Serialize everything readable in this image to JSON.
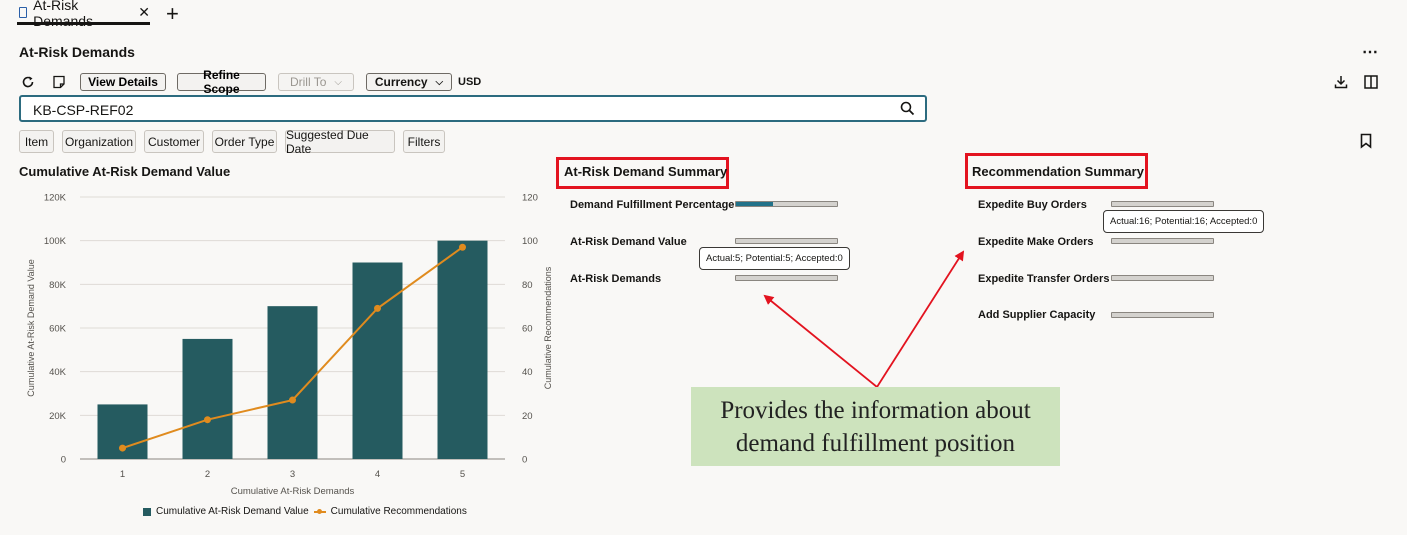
{
  "tab": {
    "label": "At-Risk Demands"
  },
  "page": {
    "title": "At-Risk Demands",
    "more": "⋯"
  },
  "toolbar": {
    "view_details": "View Details",
    "refine_scope": "Refine Scope",
    "drill_to": "Drill To",
    "currency": "Currency",
    "currency_value": "USD"
  },
  "search": {
    "value": "KB-CSP-REF02"
  },
  "filters": [
    "Item",
    "Organization",
    "Customer",
    "Order Type",
    "Suggested Due Date",
    "Filters"
  ],
  "chart_data": {
    "type": "bar",
    "title": "Cumulative At-Risk Demand Value",
    "xlabel": "Cumulative At-Risk Demands",
    "ylabel": "Cumulative At-Risk Demand Value",
    "y2label": "Cumulative Recommendations",
    "categories": [
      "1",
      "2",
      "3",
      "4",
      "5"
    ],
    "ylim": [
      0,
      120000
    ],
    "y2lim": [
      0,
      120
    ],
    "yticks": [
      "0",
      "20K",
      "40K",
      "60K",
      "80K",
      "100K",
      "120K"
    ],
    "y2ticks": [
      "0",
      "20",
      "40",
      "60",
      "80",
      "100",
      "120"
    ],
    "series": [
      {
        "name": "Cumulative At-Risk Demand Value",
        "kind": "bar",
        "axis": "y",
        "color": "#255b60",
        "values": [
          25000,
          55000,
          70000,
          90000,
          100000
        ]
      },
      {
        "name": "Cumulative Recommendations",
        "kind": "line",
        "axis": "y2",
        "color": "#e08b1e",
        "values": [
          5,
          18,
          27,
          69,
          97
        ]
      }
    ],
    "legend": "bottom",
    "grid": true
  },
  "demand_summary": {
    "title": "At-Risk Demand Summary",
    "metrics": [
      {
        "label": "Demand Fulfillment Percentage",
        "fill": 0.37
      },
      {
        "label": "At-Risk Demand Value",
        "fill": 0
      },
      {
        "label": "At-Risk Demands",
        "fill": 0
      }
    ],
    "tooltip": "Actual:5; Potential:5; Accepted:0"
  },
  "recommendation_summary": {
    "title": "Recommendation Summary",
    "metrics": [
      {
        "label": "Expedite Buy Orders",
        "fill": 0
      },
      {
        "label": "Expedite Make Orders",
        "fill": 0
      },
      {
        "label": "Expedite Transfer Orders",
        "fill": 0
      },
      {
        "label": "Add Supplier Capacity",
        "fill": 0
      }
    ],
    "tooltip": "Actual:16; Potential:16; Accepted:0"
  },
  "annotation": {
    "text": "Provides the information about demand fulfillment position",
    "color": "#e3131f"
  }
}
